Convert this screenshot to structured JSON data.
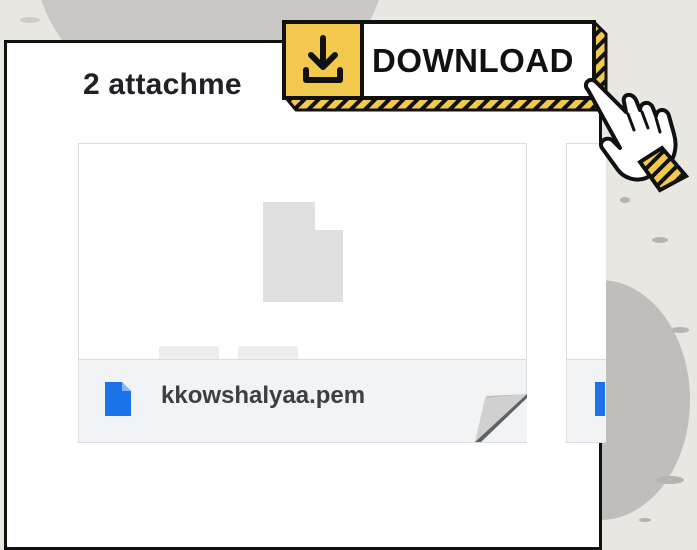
{
  "colors": {
    "background": "#e9e7e2",
    "accent_yellow": "#f2c94c",
    "file_icon_blue": "#1a73e8",
    "border_dark": "#111111"
  },
  "attachments": {
    "heading": "2 attachme",
    "files": [
      {
        "name": "kkowshalyaa.pem",
        "icon": "google-doc-file-icon"
      }
    ]
  },
  "banner": {
    "label": "DOWNLOAD",
    "icon": "download-arrow-icon"
  },
  "decor": {
    "pointer_icon": "pointing-hand-icon",
    "page_icon": "blank-file-icon"
  }
}
